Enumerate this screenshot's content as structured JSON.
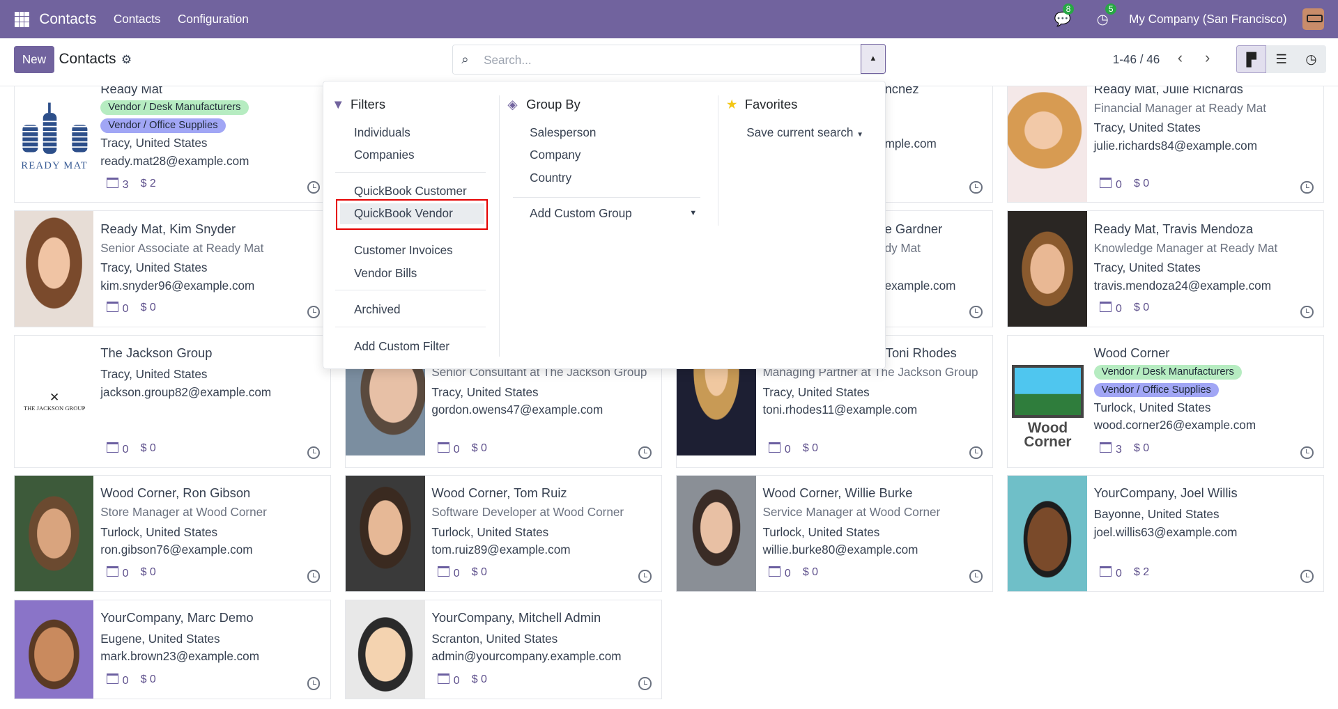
{
  "topbar": {
    "app": "Contacts",
    "menu": [
      "Contacts",
      "Configuration"
    ],
    "messages_count": "8",
    "activities_count": "5",
    "company": "My Company (San Francisco)"
  },
  "control": {
    "new": "New",
    "title": "Contacts",
    "search_placeholder": "Search...",
    "pager": "1-46 / 46"
  },
  "dropdown": {
    "filters": {
      "title": "Filters",
      "items": [
        "Individuals",
        "Companies",
        "QuickBook Customer",
        "QuickBook Vendor",
        "Customer Invoices",
        "Vendor Bills",
        "Archived",
        "Add Custom Filter"
      ]
    },
    "group_by": {
      "title": "Group By",
      "items": [
        "Salesperson",
        "Company",
        "Country"
      ],
      "custom": "Add Custom Group"
    },
    "favorites": {
      "title": "Favorites",
      "save": "Save current search"
    }
  },
  "cards": {
    "ready_mat": {
      "name": "Ready Mat",
      "tags": [
        "Vendor / Desk Manufacturers",
        "Vendor / Office Supplies"
      ],
      "location": "Tracy, United States",
      "email": "ready.mat28@example.com",
      "meetings": "3",
      "amount": "$ 2",
      "logo": "READY MAT"
    },
    "sanchez": {
      "name": "nchez",
      "email": "mple.com"
    },
    "julie": {
      "name": "Ready Mat, Julie Richards",
      "sub": "Financial Manager at Ready Mat",
      "location": "Tracy, United States",
      "email": "julie.richards84@example.com",
      "meetings": "0",
      "amount": "$ 0"
    },
    "kim": {
      "name": "Ready Mat, Kim Snyder",
      "sub": "Senior Associate at Ready Mat",
      "location": "Tracy, United States",
      "email": "kim.snyder96@example.com",
      "meetings": "0",
      "amount": "$ 0"
    },
    "gardner": {
      "name": "e Gardner",
      "sub": "dy Mat",
      "email": "example.com"
    },
    "travis": {
      "name": "Ready Mat, Travis Mendoza",
      "sub": "Knowledge Manager at Ready Mat",
      "location": "Tracy, United States",
      "email": "travis.mendoza24@example.com",
      "meetings": "0",
      "amount": "$ 0"
    },
    "jackson": {
      "name": "The Jackson Group",
      "location": "Tracy, United States",
      "email": "jackson.group82@example.com",
      "meetings": "0",
      "amount": "$ 0",
      "logo": "THE JACKSON GROUP"
    },
    "gordon": {
      "sub": "Senior Consultant at The Jackson Group",
      "location": "Tracy, United States",
      "email": "gordon.owens47@example.com",
      "meetings": "0",
      "amount": "$ 0"
    },
    "toni": {
      "name": "Toni Rhodes",
      "sub": "Managing Partner at The Jackson Group",
      "location": "Tracy, United States",
      "email": "toni.rhodes11@example.com",
      "meetings": "0",
      "amount": "$ 0"
    },
    "wood": {
      "name": "Wood Corner",
      "tags": [
        "Vendor / Desk Manufacturers",
        "Vendor / Office Supplies"
      ],
      "location": "Turlock, United States",
      "email": "wood.corner26@example.com",
      "meetings": "3",
      "amount": "$ 0",
      "logo": "Wood Corner"
    },
    "ron": {
      "name": "Wood Corner, Ron Gibson",
      "sub": "Store Manager at Wood Corner",
      "location": "Turlock, United States",
      "email": "ron.gibson76@example.com",
      "meetings": "0",
      "amount": "$ 0"
    },
    "tom": {
      "name": "Wood Corner, Tom Ruiz",
      "sub": "Software Developer at Wood Corner",
      "location": "Turlock, United States",
      "email": "tom.ruiz89@example.com",
      "meetings": "0",
      "amount": "$ 0"
    },
    "willie": {
      "name": "Wood Corner, Willie Burke",
      "sub": "Service Manager at Wood Corner",
      "location": "Turlock, United States",
      "email": "willie.burke80@example.com",
      "meetings": "0",
      "amount": "$ 0"
    },
    "joel": {
      "name": "YourCompany, Joel Willis",
      "location": "Bayonne, United States",
      "email": "joel.willis63@example.com",
      "meetings": "0",
      "amount": "$ 2"
    },
    "marc": {
      "name": "YourCompany, Marc Demo",
      "location": "Eugene, United States",
      "email": "mark.brown23@example.com",
      "meetings": "0",
      "amount": "$ 0"
    },
    "mitchell": {
      "name": "YourCompany, Mitchell Admin",
      "location": "Scranton, United States",
      "email": "admin@yourcompany.example.com",
      "meetings": "0",
      "amount": "$ 0"
    }
  },
  "colors": {
    "brand": "#71639e",
    "tag_green": "#b6ecc1",
    "tag_blue": "#a1a6f5",
    "highlight": "#e50000"
  }
}
